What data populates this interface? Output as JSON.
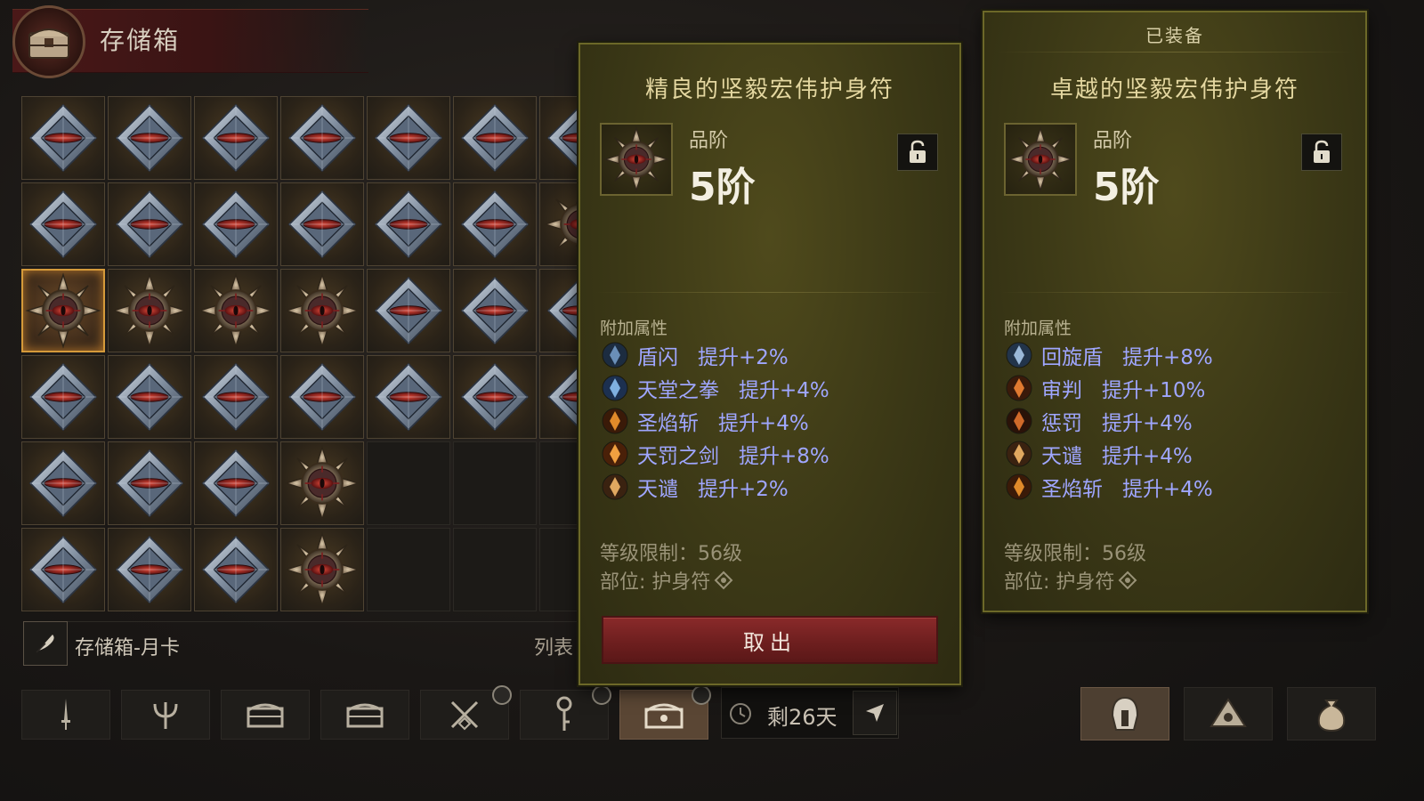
{
  "header": {
    "title": "存储箱"
  },
  "grid": {
    "rows": [
      [
        "amulet-blue",
        "amulet-blue",
        "amulet-blue",
        "amulet-blue",
        "amulet-blue",
        "amulet-blue",
        "amulet-blue"
      ],
      [
        "amulet-blue",
        "amulet-blue",
        "amulet-blue",
        "amulet-blue",
        "amulet-blue",
        "amulet-blue",
        "amulet-gold"
      ],
      [
        "amulet-gold-selected",
        "amulet-gold",
        "amulet-gold",
        "amulet-gold",
        "amulet-blue",
        "amulet-blue",
        "amulet-blue"
      ],
      [
        "amulet-blue",
        "amulet-blue",
        "amulet-blue",
        "amulet-blue",
        "amulet-blue",
        "amulet-blue",
        "amulet-blue"
      ],
      [
        "amulet-blue",
        "amulet-blue",
        "amulet-blue",
        "amulet-gold",
        "empty",
        "empty",
        "empty"
      ],
      [
        "amulet-blue",
        "amulet-blue",
        "amulet-blue",
        "amulet-gold",
        "empty",
        "empty",
        "empty"
      ]
    ]
  },
  "footer": {
    "storage_name": "存储箱-月卡",
    "list_label": "列表",
    "timer_text": "剩26天"
  },
  "tabs": [
    "sword-icon",
    "trident-icon",
    "chest-icon",
    "chest-icon",
    "weapon-timer-icon",
    "key-icon",
    "chest-active-icon"
  ],
  "right_tabs": [
    "helmet-icon",
    "material-icon",
    "pouch-icon"
  ],
  "selected_item": {
    "title": "精良的坚毅宏伟护身符",
    "grade_label": "品阶",
    "grade_value": "5阶",
    "attr_header": "附加属性",
    "attrs": [
      {
        "name": "盾闪",
        "bonus": "提升+2%",
        "icon": "shield-flash-icon"
      },
      {
        "name": "天堂之拳",
        "bonus": "提升+4%",
        "icon": "heaven-fist-icon"
      },
      {
        "name": "圣焰斩",
        "bonus": "提升+4%",
        "icon": "holy-flame-slash-icon"
      },
      {
        "name": "天罚之剑",
        "bonus": "提升+8%",
        "icon": "punish-sword-icon"
      },
      {
        "name": "天谴",
        "bonus": "提升+2%",
        "icon": "wrath-icon"
      }
    ],
    "level_req": "等级限制：56级",
    "slot": "部位: 护身符",
    "take_button": "取出"
  },
  "equipped_item": {
    "tag": "已装备",
    "title": "卓越的坚毅宏伟护身符",
    "grade_label": "品阶",
    "grade_value": "5阶",
    "attr_header": "附加属性",
    "attrs": [
      {
        "name": "回旋盾",
        "bonus": "提升+8%",
        "icon": "spin-shield-icon"
      },
      {
        "name": "审判",
        "bonus": "提升+10%",
        "icon": "judgement-icon"
      },
      {
        "name": "惩罚",
        "bonus": "提升+4%",
        "icon": "punishment-icon"
      },
      {
        "name": "天谴",
        "bonus": "提升+4%",
        "icon": "wrath-icon"
      },
      {
        "name": "圣焰斩",
        "bonus": "提升+4%",
        "icon": "holy-flame-slash-icon"
      }
    ],
    "level_req": "等级限制：56级",
    "slot": "部位: 护身符"
  },
  "colors": {
    "panel_bg": "#3b3816",
    "attr_text": "#9fa6ff",
    "selected_border": "#d59a3a",
    "button_red": "#7a2424"
  }
}
